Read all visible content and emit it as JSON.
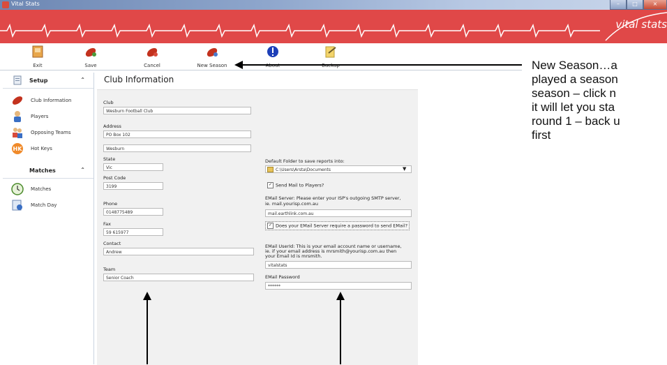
{
  "window": {
    "title": "Vital Stats"
  },
  "banner": {
    "brand": "vital stats"
  },
  "toolbar": {
    "exit": "Exit",
    "save": "Save",
    "cancel": "Cancel",
    "new_season": "New Season",
    "about": "About",
    "backup": "Backup"
  },
  "sidebar": {
    "setup_header": "Setup",
    "setup_items": [
      "Club Information",
      "Players",
      "Opposing Teams",
      "Hot Keys"
    ],
    "matches_header": "Matches",
    "matches_items": [
      "Matches",
      "Match Day"
    ]
  },
  "main": {
    "title": "Club Information",
    "club_label": "Club",
    "club_value": "Wesburn Football Club",
    "address_label": "Address",
    "address_line1": "PO Box 102",
    "address_line2": "Wesburn",
    "state_label": "State",
    "state_value": "Vic",
    "postcode_label": "Post Code",
    "postcode_value": "3199",
    "phone_label": "Phone",
    "phone_value": "0148775489",
    "fax_label": "Fax",
    "fax_value": "59 615977",
    "contact_label": "Contact",
    "contact_value": "Andrew",
    "team_label": "Team",
    "team_value": "Senior Coach",
    "folder_label": "Default Folder to save reports into:",
    "folder_value": "C:\\Users\\Arsta\\Documents",
    "send_mail_label": "Send Mail to Players?",
    "email_server_label_1": "EMail Server: Please enter your ISP's outgoing SMTP server,",
    "email_server_label_2": "ie. mail.yourisp.com.au",
    "email_server_value": "mail.earthlink.com.au",
    "password_required_label": "Does your EMail Server require a password to send EMail?",
    "userid_label_1": "EMail UserId: This is your email account name or username,",
    "userid_label_2": "ie. if your email address is mrsmith@yourisp.com.au then",
    "userid_label_3": "your Email Id is mrsmith.",
    "userid_value": "vitalstats",
    "password_label": "EMail Password",
    "password_value": "******"
  },
  "callout": {
    "lines": [
      "New Season…a",
      "played a season",
      "season – click n",
      "it will let you sta",
      "round 1 – back u",
      "first"
    ]
  },
  "colors": {
    "banner": "#e04848",
    "titlebar": "#8ea6cc"
  }
}
